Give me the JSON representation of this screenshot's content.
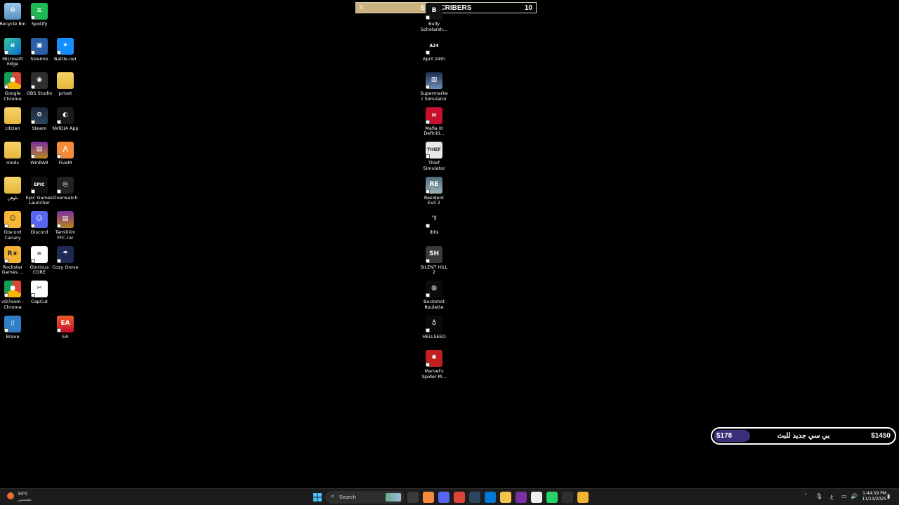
{
  "overlay_subscribers": {
    "current": "4",
    "title": "SUBSCRIBERS",
    "goal": "10",
    "progress": 0.4
  },
  "overlay_donation": {
    "current": "$178",
    "title": "بي سي جديد للبث",
    "goal": "$1450",
    "progress": 0.123
  },
  "desktop_icons": [
    {
      "label": "Recycle Bin",
      "icon": "recycle-bin-icon"
    },
    {
      "label": "Spotify",
      "icon": "spotify-icon"
    },
    {
      "label": "Microsoft Edge",
      "icon": "edge-icon"
    },
    {
      "label": "Stremio",
      "icon": "stremio-icon"
    },
    {
      "label": "Battle.net",
      "icon": "battlenet-icon"
    },
    {
      "label": "Google Chrome",
      "icon": "chrome-icon"
    },
    {
      "label": "OBS Studio",
      "icon": "obs-icon"
    },
    {
      "label": "privet",
      "icon": "folder-icon"
    },
    {
      "label": "citizen",
      "icon": "folder-icon"
    },
    {
      "label": "Steam",
      "icon": "steam-icon"
    },
    {
      "label": "NVIDIA App",
      "icon": "nvidia-icon"
    },
    {
      "label": "mods",
      "icon": "folder-icon"
    },
    {
      "label": "WinRAR",
      "icon": "winrar-icon"
    },
    {
      "label": "FiveM",
      "icon": "fivem-icon"
    },
    {
      "label": "بلوفن",
      "icon": "folder-icon"
    },
    {
      "label": "Epic Games Launcher",
      "icon": "epic-games-icon"
    },
    {
      "label": "Overwatch",
      "icon": "overwatch-icon"
    },
    {
      "label": "Discord Canary",
      "icon": "discord-canary-icon"
    },
    {
      "label": "Discord",
      "icon": "discord-icon"
    },
    {
      "label": "Tamiiiiim FFC.rar",
      "icon": "winrar-archive-icon"
    },
    {
      "label": "Rockstar Games ...",
      "icon": "rockstar-icon"
    },
    {
      "label": "Glorious CORE",
      "icon": "glorious-icon"
    },
    {
      "label": "Cozy Grove",
      "icon": "cozy-grove-icon"
    },
    {
      "label": "vD7oom - Chrome",
      "icon": "chrome-icon"
    },
    {
      "label": "CapCut",
      "icon": "capcut-icon"
    },
    {
      "label": "Brave",
      "icon": "brave-icon"
    },
    {
      "label": "EA",
      "icon": "ea-icon"
    }
  ],
  "game_icons": [
    {
      "label": "Bully Scholarsh...",
      "icon": "bully-icon"
    },
    {
      "label": "April 24th",
      "icon": "april24th-icon"
    },
    {
      "label": "Supermarket Simulator",
      "icon": "supermarket-simulator-icon"
    },
    {
      "label": "Mafia III Definiti...",
      "icon": "mafia-icon"
    },
    {
      "label": "Thief Simulator",
      "icon": "thief-simulator-icon"
    },
    {
      "label": "Resident Evil 2",
      "icon": "resident-evil-icon"
    },
    {
      "label": "iblis",
      "icon": "iblis-icon"
    },
    {
      "label": "SILENT HILL 2",
      "icon": "silent-hill-icon"
    },
    {
      "label": "Buckshot Roulette",
      "icon": "buckshot-roulette-icon"
    },
    {
      "label": "HELLSEED",
      "icon": "hellseed-icon"
    },
    {
      "label": "Marvel's Spider-M...",
      "icon": "spiderman-icon"
    }
  ],
  "taskbar": {
    "weather": {
      "temp": "34°C",
      "desc": "مشمس",
      "icon": "weather-sun-icon"
    },
    "search_label": "Search",
    "apps": [
      "file-explorer-window-icon",
      "fivem-icon",
      "discord-icon",
      "chrome-icon",
      "steam-icon",
      "microsoft-store-icon",
      "file-explorer-icon",
      "winrar-icon",
      "capcut-icon",
      "whatsapp-icon",
      "obs-icon",
      "chrome-canary-icon"
    ],
    "tray_lang": "ع",
    "time": "1:44:59 PM",
    "date": "11/13/2025"
  },
  "colors": {
    "sub_fill": "#c9b27d",
    "donate_fill": "#3a2f7a",
    "taskbar": "#1c1c1c"
  }
}
